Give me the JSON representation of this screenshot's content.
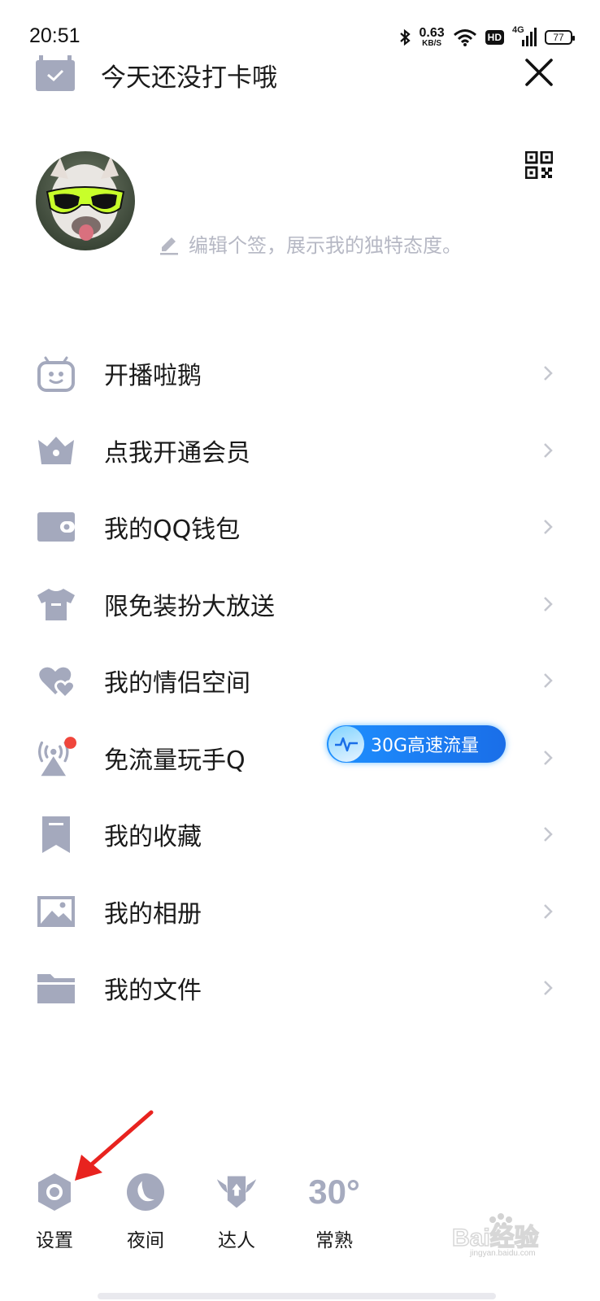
{
  "status_bar": {
    "time": "20:51",
    "net_speed_value": "0.63",
    "net_speed_unit": "KB/S",
    "hd_label": "HD",
    "signal_label": "4G",
    "battery": "77"
  },
  "header": {
    "checkin_text": "今天还没打卡哦"
  },
  "profile": {
    "signature_placeholder": "编辑个签，展示我的独特态度。"
  },
  "menu": {
    "items": [
      {
        "label": "开播啦鹅",
        "icon": "tv-robot-icon"
      },
      {
        "label": "点我开通会员",
        "icon": "crown-icon"
      },
      {
        "label": "我的QQ钱包",
        "icon": "wallet-icon"
      },
      {
        "label": "限免装扮大放送",
        "icon": "tshirt-icon"
      },
      {
        "label": "我的情侣空间",
        "icon": "hearts-icon"
      },
      {
        "label": "免流量玩手Q",
        "icon": "antenna-icon",
        "badge": "30G高速流量"
      },
      {
        "label": "我的收藏",
        "icon": "bookmark-icon"
      },
      {
        "label": "我的相册",
        "icon": "image-icon"
      },
      {
        "label": "我的文件",
        "icon": "folder-icon"
      }
    ]
  },
  "bottom": {
    "settings": "设置",
    "night": "夜间",
    "expert": "达人",
    "weather_temp": "30°",
    "weather_city": "常熟"
  },
  "watermark": {
    "brand": "Bai经验",
    "url": "jingyan.baidu.com"
  },
  "colors": {
    "icon_gray": "#a4a9bd",
    "promo_blue": "#1e88f5",
    "notify_red": "#f0463c",
    "annotation_red": "#e8231f"
  }
}
